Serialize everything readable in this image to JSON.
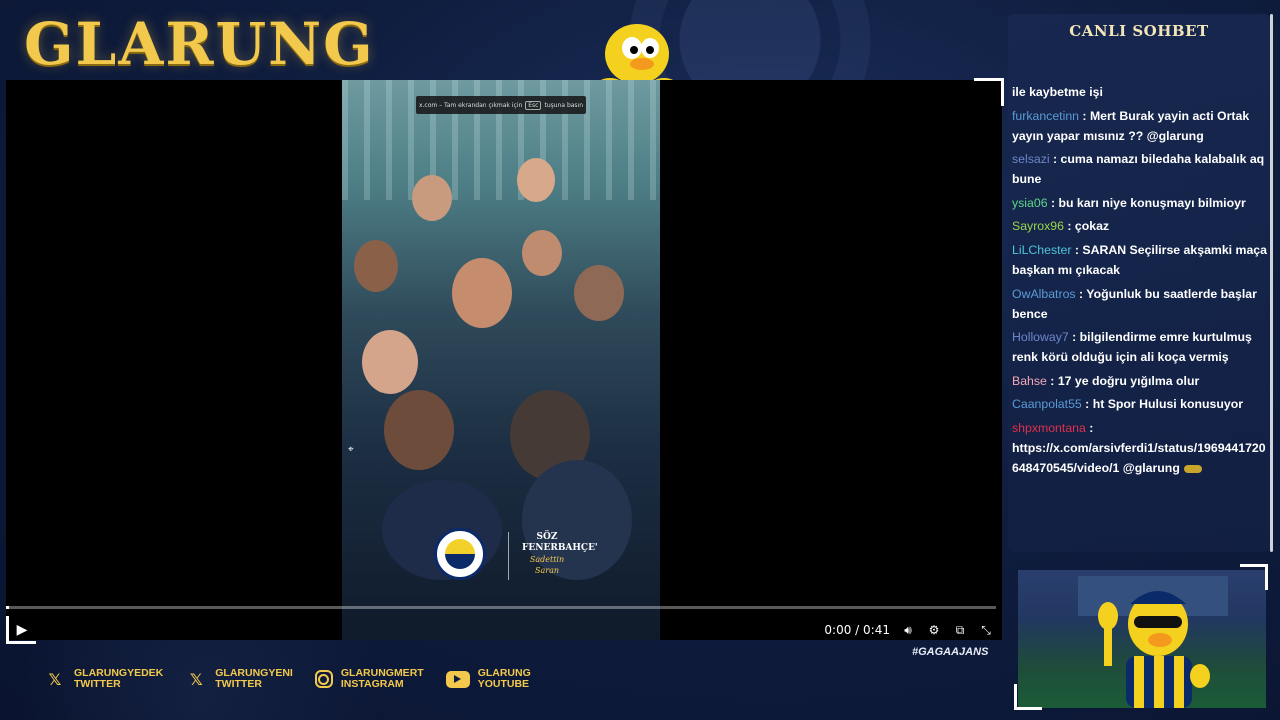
{
  "brand": {
    "logo_text": "GLARUNG",
    "accent_color": "#f2c94c"
  },
  "player": {
    "fullscreen_notice": {
      "prefix": "x.com – Tam ekrandan çıkmak için",
      "key": "Esc",
      "suffix": "tuşuna basın"
    },
    "time_display": "0:00 / 0:41",
    "progress_fraction": 0.0,
    "play_icon": "play-icon",
    "controls": [
      "volume-icon",
      "settings-icon",
      "pip-icon",
      "exit-fullscreen-icon"
    ],
    "video_overlay": {
      "crest_name": "fenerbahce-crest",
      "soz_line1": "SÖZ",
      "soz_line2": "FENERBAHÇE'",
      "signature": "Sadettin Saran"
    }
  },
  "hashtag": "#GAGAAJANS",
  "socials": [
    {
      "icon": "x-icon",
      "line1": "GLARUNGYEDEK",
      "line2": "TWITTER"
    },
    {
      "icon": "x-icon",
      "line1": "GLARUNGYENI",
      "line2": "TWITTER"
    },
    {
      "icon": "instagram-icon",
      "line1": "GLARUNGMERT",
      "line2": "INSTAGRAM"
    },
    {
      "icon": "youtube-icon",
      "line1": "GLARUNG",
      "line2": "YOUTUBE"
    }
  ],
  "chat": {
    "title": "CANLI SOHBET",
    "messages": [
      {
        "user": "",
        "color": "#ffffff",
        "text": "ile kaybetme işi"
      },
      {
        "user": "furkancetinn",
        "color": "#5b9bd5",
        "text": "Mert Burak yayin acti Ortak yayın yapar mısınız ?? @glarung"
      },
      {
        "user": "selsazi",
        "color": "#6f86c9",
        "text": "cuma namazı biledaha kalabalık aq bune"
      },
      {
        "user": "ysia06",
        "color": "#5fd68a",
        "text": "bu karı niye konuşmayı bilmioyr"
      },
      {
        "user": "Sayrox96",
        "color": "#9ad54a",
        "text": "çokaz"
      },
      {
        "user": "LiLChester",
        "color": "#4fc3d9",
        "text": "SARAN Seçilirse akşamki maça başkan mı çıkacak"
      },
      {
        "user": "OwAlbatros",
        "color": "#5b9bd5",
        "text": "Yoğunluk bu saatlerde başlar bence"
      },
      {
        "user": "Holloway7",
        "color": "#6f86c9",
        "text": "bilgilendirme emre kurtulmuş renk körü olduğu için ali koça vermiş"
      },
      {
        "user": "Bahse",
        "color": "#f4a7b9",
        "text": "17 ye doğru yığılma olur"
      },
      {
        "user": "Caanpolat55",
        "color": "#5b9bd5",
        "text": "ht Spor Hulusi konusuyor"
      },
      {
        "user": "shpxmontana",
        "color": "#e0304a",
        "text": "https://x.com/arsivferdi1/status/1969441720648470545/video/1 @glarung",
        "emote": true
      }
    ]
  }
}
